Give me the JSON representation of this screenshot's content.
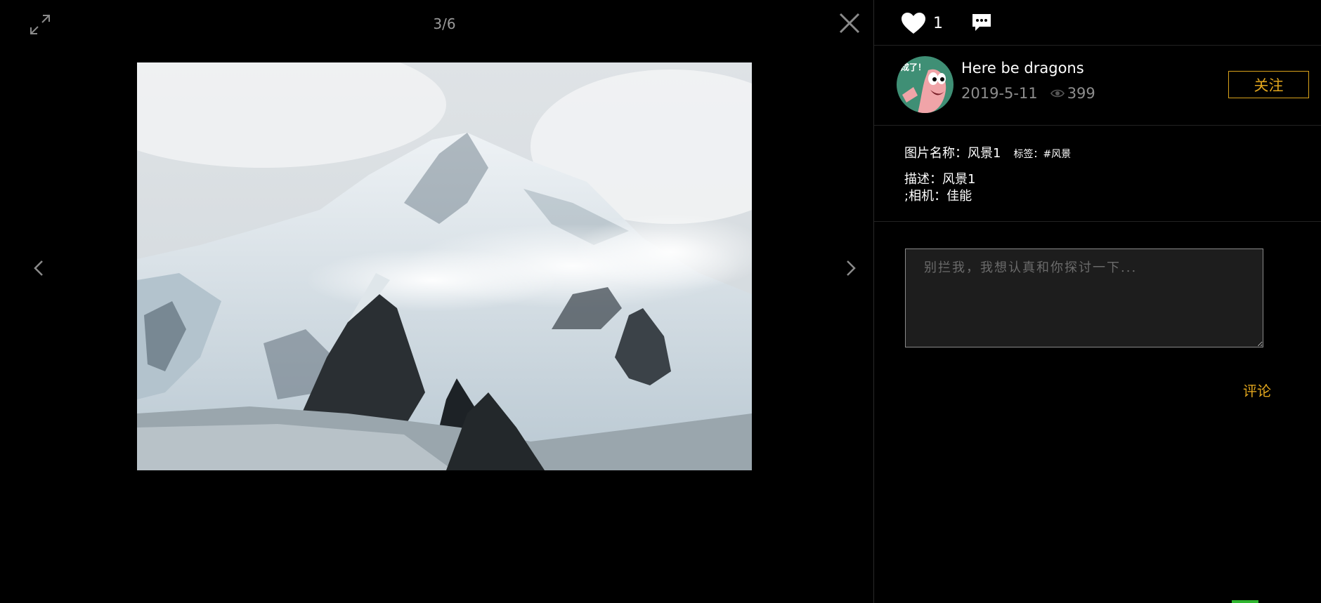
{
  "viewer": {
    "counter": "3/6",
    "icons": {
      "fullscreen": "expand-icon",
      "close": "close-icon",
      "prev": "chevron-left-icon",
      "next": "chevron-right-icon"
    }
  },
  "actions": {
    "like_count": "1",
    "like_icon": "heart-icon",
    "comment_icon": "speech-bubble-icon"
  },
  "author": {
    "avatar_text": "成了！",
    "name": "Here be dragons",
    "date": "2019-5-11",
    "views": "399",
    "follow_label": "关注"
  },
  "info": {
    "picture_name": "图片名称：风景1",
    "tags": "标签：#风景",
    "description": "描述：风景1",
    "camera": ";相机：佳能"
  },
  "comment": {
    "placeholder": "别拦我，我想认真和你探讨一下...",
    "submit_label": "评论"
  },
  "colors": {
    "accent": "#e0a51d",
    "background": "#000000",
    "input_bg": "#1d1d1d"
  }
}
